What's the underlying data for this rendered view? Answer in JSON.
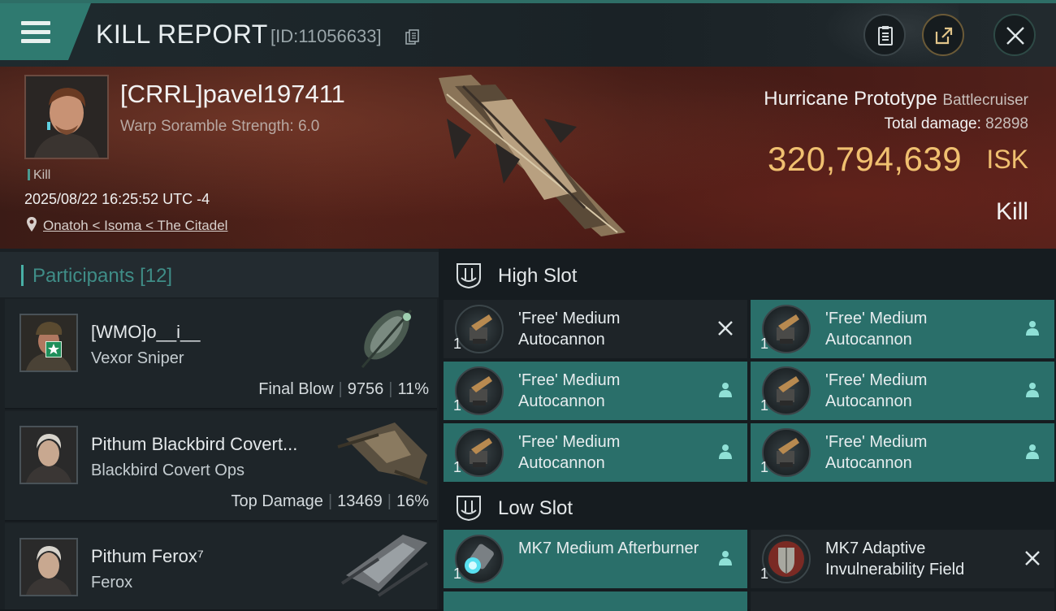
{
  "header": {
    "title": "KILL REPORT",
    "report_id": "[ID:11056633]",
    "buttons": [
      "clipboard-icon",
      "share-icon",
      "close-icon"
    ]
  },
  "victim": {
    "name": "[CRRL]pavel197411",
    "scramble": "Warp Soramble Strength: 6.0",
    "kill_tag": "Kill",
    "datetime": "2025/08/22 16:25:52 UTC -4",
    "location": "Onatoh < Isoma < The Citadel",
    "ship_name": "Hurricane Prototype",
    "ship_class": "Battlecruiser",
    "total_damage_label": "Total damage:",
    "total_damage": "82898",
    "isk_value": "320,794,639",
    "isk_unit": "ISK",
    "result": "Kill"
  },
  "participants": {
    "title": "Participants",
    "count": "[12]",
    "rows": [
      {
        "name": "[WMO]o__i__",
        "ship": "Vexor Sniper",
        "stat_label": "Final Blow",
        "damage": "9756",
        "percent": "11%"
      },
      {
        "name": "Pithum Blackbird Covert...",
        "ship": "Blackbird Covert Ops",
        "stat_label": "Top Damage",
        "damage": "13469",
        "percent": "16%"
      },
      {
        "name": "Pithum Ferox⁷",
        "ship": "Ferox",
        "stat_label": "",
        "damage": "",
        "percent": ""
      }
    ]
  },
  "fitting": {
    "high_slot": {
      "title": "High Slot",
      "modules": [
        {
          "qty": "1",
          "name": "'Free' Medium Autocannon",
          "state": "destroyed"
        },
        {
          "qty": "1",
          "name": "'Free' Medium Autocannon",
          "state": "dropped"
        },
        {
          "qty": "1",
          "name": "'Free' Medium Autocannon",
          "state": "dropped"
        },
        {
          "qty": "1",
          "name": "'Free' Medium Autocannon",
          "state": "dropped"
        },
        {
          "qty": "1",
          "name": "'Free' Medium Autocannon",
          "state": "dropped"
        },
        {
          "qty": "1",
          "name": "'Free' Medium Autocannon",
          "state": "dropped"
        }
      ]
    },
    "low_slot": {
      "title": "Low Slot",
      "modules": [
        {
          "qty": "1",
          "name": "MK7 Medium Afterburner",
          "state": "dropped"
        },
        {
          "qty": "1",
          "name": "MK7 Adaptive Invulnerability Field",
          "state": "destroyed"
        }
      ]
    }
  },
  "colors": {
    "accent_teal": "#2a6f6a",
    "isk_gold": "#f0c070",
    "banner_red": "#4d2119"
  }
}
